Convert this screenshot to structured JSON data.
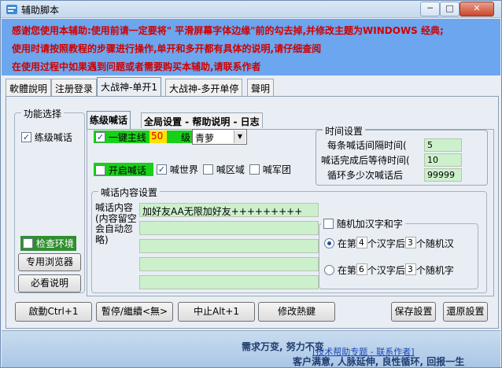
{
  "window": {
    "title": "辅助脚本",
    "min_label": "─",
    "max_label": "□",
    "close_label": "✕"
  },
  "notice": {
    "line1": "感谢您使用本辅助:使用前请一定要将\" 平滑屏幕字体边缘\"前的勾去掉,并修改主题为WINDOWS 经典;",
    "line2": "使用时请按照教程的步骤进行操作,单开和多开都有具体的说明,请仔细查阅",
    "line3": "在使用过程中如果遇到问题或者需要购买本辅助,请联系作者",
    "color": "#d00000",
    "bg": "#6ba6ee"
  },
  "tabs": [
    {
      "label": "軟體說明"
    },
    {
      "label": "注册登录"
    },
    {
      "label": "大战神-单开1"
    },
    {
      "label": "大战神-多开单停"
    },
    {
      "label": "聲明"
    }
  ],
  "function_select": {
    "title": "功能选择",
    "practice_shout_label": "练级喊话",
    "practice_shout_checked": true,
    "check_env_label": "检查环境",
    "check_env_checked": false,
    "browser_button": "专用浏览器",
    "must_read_button": "必看说明"
  },
  "inner_tabs": [
    {
      "label": "练级喊话"
    },
    {
      "label": "全局设置 - 帮助说明 - 日志"
    }
  ],
  "shout_panel": {
    "one_key_label": "一键主线",
    "level_value": "50",
    "level_label": "级",
    "character_value": "青萝",
    "open_shout_label": "开启喊话",
    "open_shout_checked": false,
    "world_label": "喊世界",
    "world_checked": true,
    "region_label": "喊区域",
    "region_checked": false,
    "army_label": "喊军团",
    "army_checked": false
  },
  "time_settings": {
    "title": "时间设置",
    "interval_label": "每条喊话间隔时间(",
    "interval_value": "5",
    "wait_label": "喊话完成后等待时间(",
    "wait_value": "10",
    "loop_label": "循环多少次喊话后",
    "loop_value": "99999"
  },
  "content_settings": {
    "title": "喊话内容设置",
    "content_label": "喊话内容\n(内容留空会自动忽略)",
    "lines": [
      "加好友AA无限加好友+++++++++",
      "",
      "",
      "",
      ""
    ]
  },
  "random_chars": {
    "checkbox_label": "随机加汉字和字",
    "checked": false,
    "option1_prefix": "在第",
    "option1_pos": "4",
    "option1_middle": "个汉字后",
    "option1_count": "3",
    "option1_suffix": "个随机汉",
    "option1_selected": true,
    "option2_prefix": "在第",
    "option2_pos": "6",
    "option2_middle": "个汉字后",
    "option2_count": "3",
    "option2_suffix": "个随机字",
    "option2_selected": false
  },
  "bottom_buttons": {
    "start": "啟動Ctrl+1",
    "pause": "暫停/繼續<無>",
    "stop": "中止Alt+1",
    "hotkey": "修改熱鍵",
    "save": "保存設置",
    "restore": "還原設置"
  },
  "footer": {
    "slogan": "需求万变, 努力不变",
    "link": "[技术帮助专题 - 联系作者]",
    "tagline": "客户满意, 人脉延伸, 良性循环, 回报一生"
  }
}
